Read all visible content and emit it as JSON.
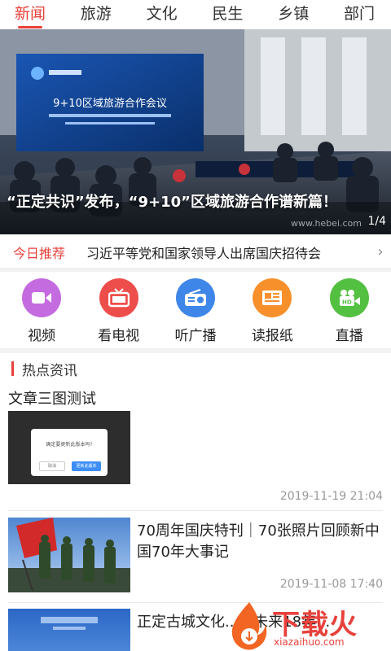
{
  "tabs": [
    {
      "label": "新闻",
      "active": true
    },
    {
      "label": "旅游",
      "active": false
    },
    {
      "label": "文化",
      "active": false
    },
    {
      "label": "民生",
      "active": false
    },
    {
      "label": "乡镇",
      "active": false
    },
    {
      "label": "部门",
      "active": false
    }
  ],
  "banner": {
    "slide_title": "9+10区域旅游合作会议",
    "caption": "“正定共识”发布，“9+10”区域旅游合作谱新篇！",
    "counter": "1/4",
    "watermark": "www.hebei.com"
  },
  "recommend": {
    "tag": "今日推荐",
    "text": "习近平等党和国家领导人出席国庆招待会"
  },
  "quick": [
    {
      "label": "视频",
      "icon": "video-camera-icon",
      "color": "#c46be0"
    },
    {
      "label": "看电视",
      "icon": "tv-icon",
      "color": "#ee4e4b"
    },
    {
      "label": "听广播",
      "icon": "radio-icon",
      "color": "#3e86e8"
    },
    {
      "label": "读报纸",
      "icon": "newspaper-icon",
      "color": "#f7902b"
    },
    {
      "label": "直播",
      "icon": "hd-camera-icon",
      "color": "#54c041"
    }
  ],
  "section": {
    "title": "热点资讯"
  },
  "articles": [
    {
      "title": "文章三图测试",
      "thumb_dialog_text": "确定要更新此版本吗?",
      "thumb_dialog_cancel": "取消",
      "thumb_dialog_ok": "更新此版本",
      "time": "2019-11-19 21:04"
    },
    {
      "title": "70周年国庆特刊｜70张照片回顾新中国70年大事记",
      "time": "2019-11-08 17:40"
    },
    {
      "title": "正定古城文化...庄未来18年..."
    }
  ],
  "watermark_logo": {
    "text": "下载火",
    "sub": "xiazaihuo.com"
  },
  "colors": {
    "accent": "#e8413b"
  }
}
